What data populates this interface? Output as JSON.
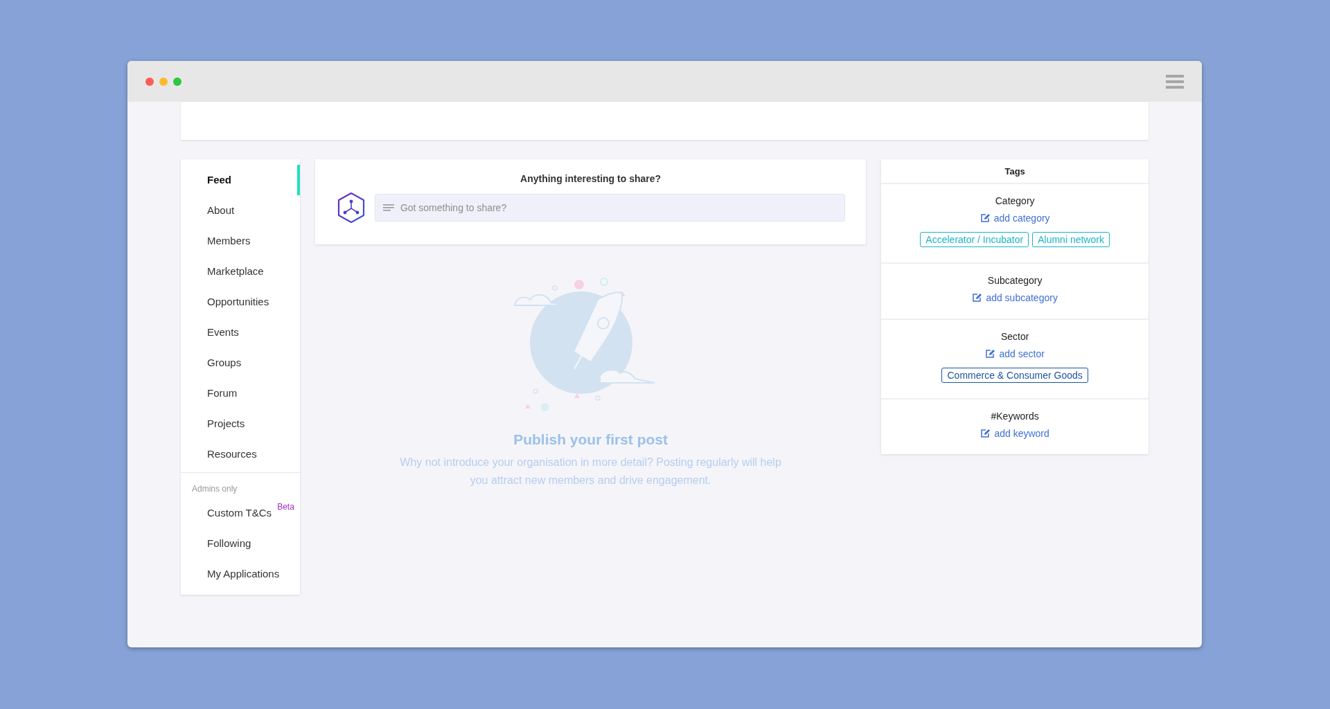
{
  "sidebar": {
    "items": [
      {
        "label": "Feed",
        "selected": true
      },
      {
        "label": "About",
        "selected": false
      },
      {
        "label": "Members",
        "selected": false
      },
      {
        "label": "Marketplace",
        "selected": false
      },
      {
        "label": "Opportunities",
        "selected": false
      },
      {
        "label": "Events",
        "selected": false
      },
      {
        "label": "Groups",
        "selected": false
      },
      {
        "label": "Forum",
        "selected": false
      },
      {
        "label": "Projects",
        "selected": false
      },
      {
        "label": "Resources",
        "selected": false
      }
    ],
    "admin_heading": "Admins only",
    "admin_items": [
      {
        "label": "Custom T&Cs",
        "selected": false,
        "badge": "Beta"
      },
      {
        "label": "Following",
        "selected": false
      },
      {
        "label": "My Applications",
        "selected": false
      }
    ]
  },
  "composer": {
    "title": "Anything interesting to share?",
    "placeholder": "Got something to share?"
  },
  "empty_state": {
    "title": "Publish your first post",
    "text": "Why not introduce your organisation in more detail? Posting regularly will help you attract new members and drive engagement."
  },
  "tags_panel": {
    "title": "Tags",
    "sections": [
      {
        "heading": "Category",
        "action": "add category",
        "tags": [
          {
            "label": "Accelerator / Incubator",
            "color": "#1ab4c8"
          },
          {
            "label": "Alumni network",
            "color": "#1ab4c8"
          }
        ]
      },
      {
        "heading": "Subcategory",
        "action": "add subcategory"
      },
      {
        "heading": "Sector",
        "action": "add sector",
        "tags": [
          {
            "label": "Commerce & Consumer Goods",
            "color": "#1d55a3"
          }
        ]
      },
      {
        "heading": "#Keywords",
        "action": "add keyword"
      }
    ]
  }
}
